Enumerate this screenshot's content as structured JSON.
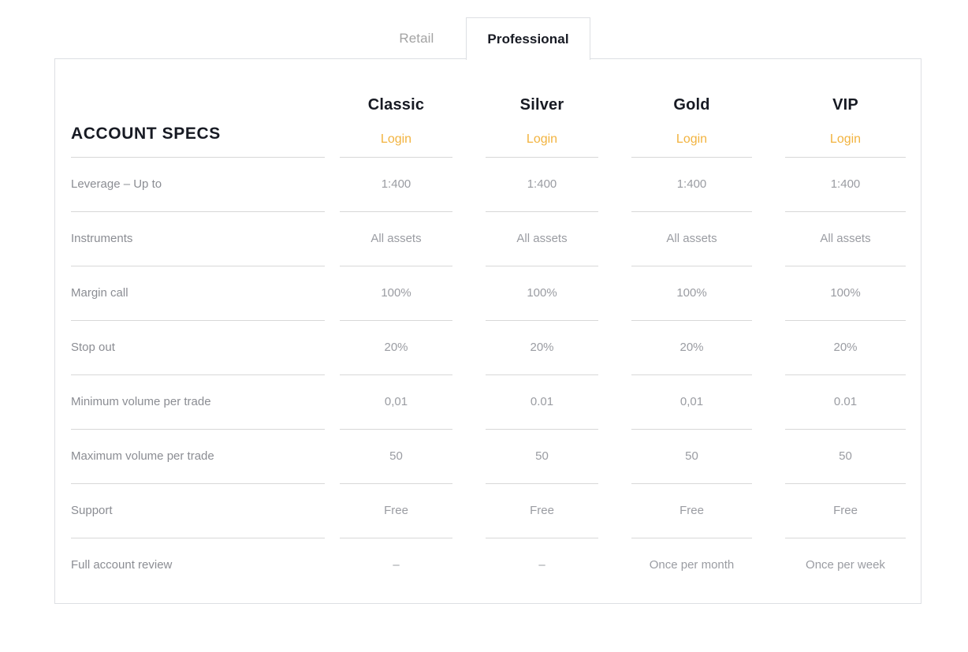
{
  "tabs": [
    {
      "label": "Retail",
      "active": false
    },
    {
      "label": "Professional",
      "active": true
    }
  ],
  "panel": {
    "specs_title": "ACCOUNT SPECS",
    "login_label": "Login",
    "login_color": "#f2b33f",
    "columns": [
      {
        "name": "Classic",
        "login": "Login"
      },
      {
        "name": "Silver",
        "login": "Login"
      },
      {
        "name": "Gold",
        "login": "Login"
      },
      {
        "name": "VIP",
        "login": "Login"
      }
    ],
    "rows": [
      {
        "label": "Leverage – Up to",
        "values": [
          "1:400",
          "1:400",
          "1:400",
          "1:400"
        ]
      },
      {
        "label": "Instruments",
        "values": [
          "All assets",
          "All assets",
          "All assets",
          "All assets"
        ]
      },
      {
        "label": "Margin call",
        "values": [
          "100%",
          "100%",
          "100%",
          "100%"
        ]
      },
      {
        "label": "Stop out",
        "values": [
          "20%",
          "20%",
          "20%",
          "20%"
        ]
      },
      {
        "label": "Minimum volume per trade",
        "values": [
          "0,01",
          "0.01",
          "0,01",
          "0.01"
        ]
      },
      {
        "label": "Maximum volume per trade",
        "values": [
          "50",
          "50",
          "50",
          "50"
        ]
      },
      {
        "label": "Support",
        "values": [
          "Free",
          "Free",
          "Free",
          "Free"
        ]
      },
      {
        "label": "Full account review",
        "values": [
          "–",
          "–",
          "Once per month",
          "Once per week"
        ]
      }
    ]
  }
}
